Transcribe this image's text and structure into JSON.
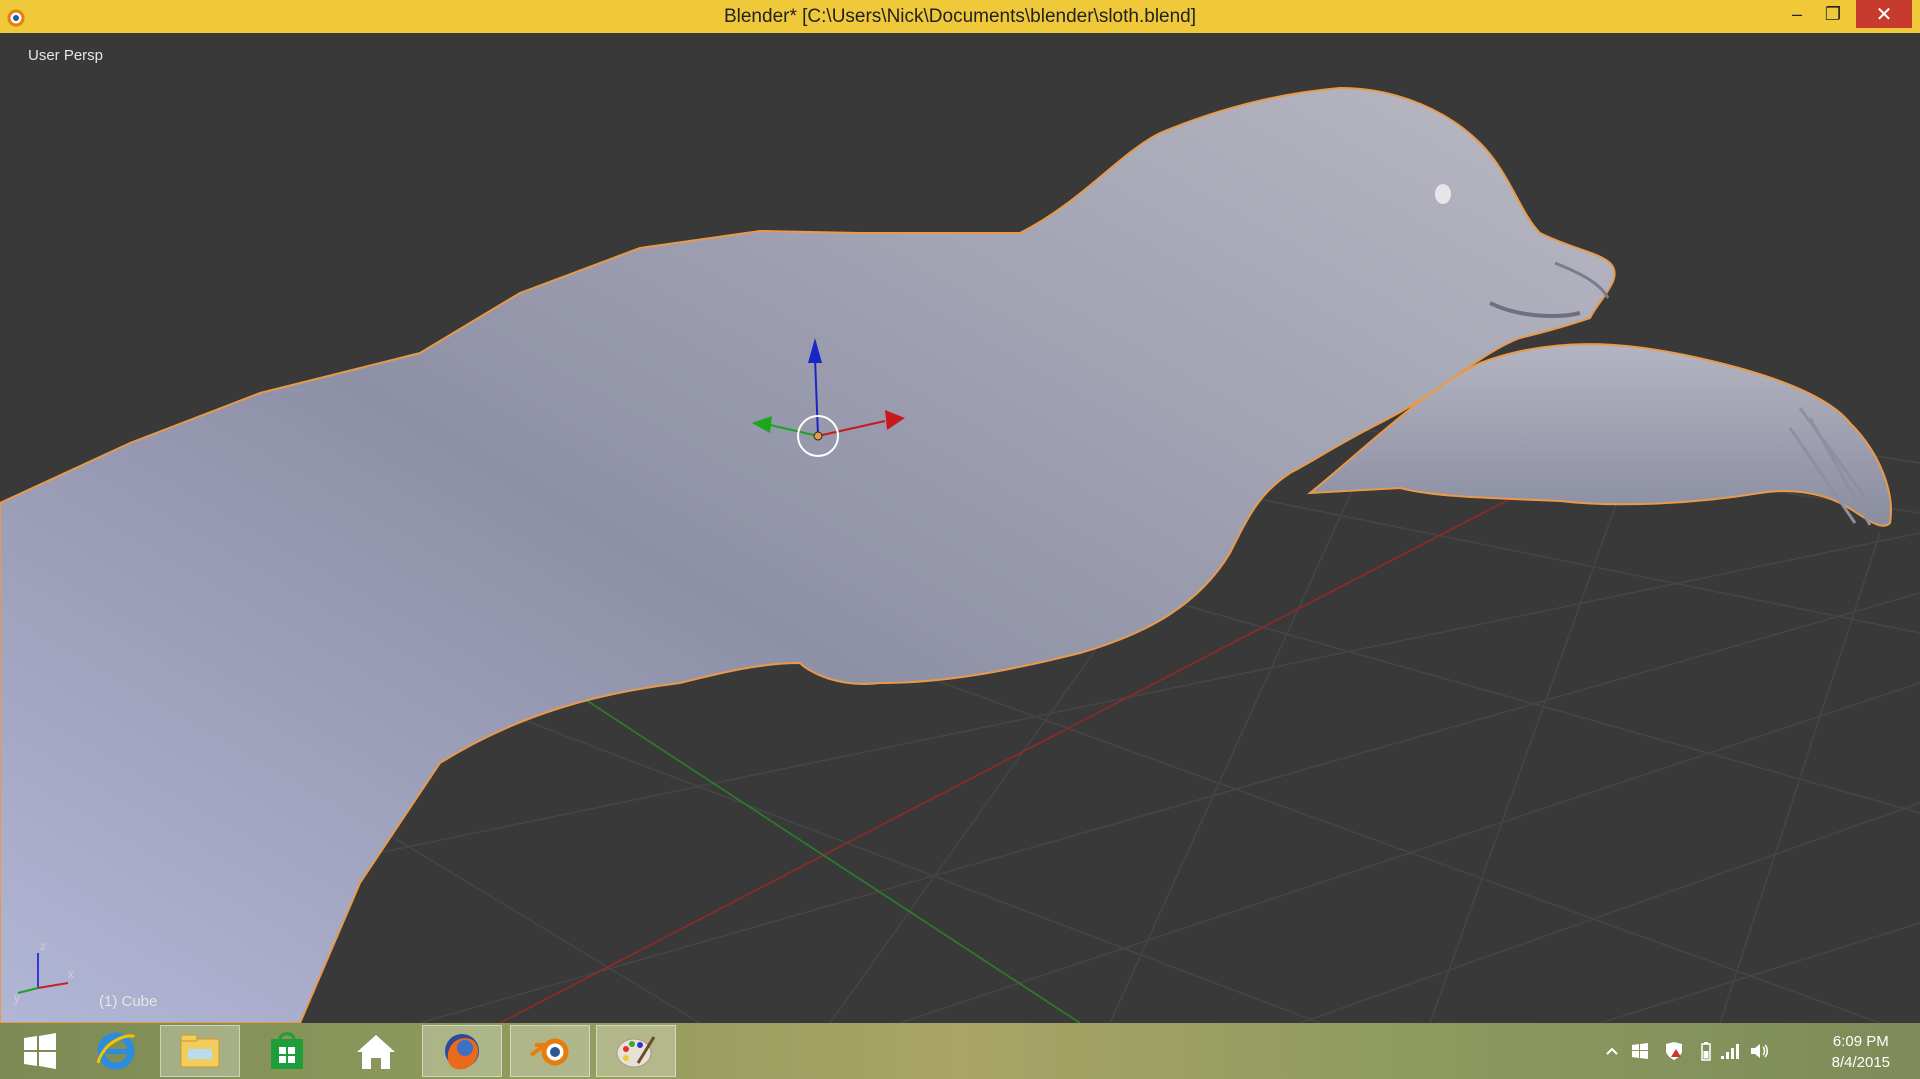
{
  "window": {
    "title": "Blender* [C:\\Users\\Nick\\Documents\\blender\\sloth.blend]",
    "minimize_label": "–",
    "maximize_label": "❐",
    "close_label": "✕"
  },
  "viewport": {
    "view_label": "User Persp",
    "object_label": "(1) Cube",
    "axis_labels": {
      "x": "x",
      "y": "y",
      "z": "z"
    },
    "background_color": "#393939",
    "grid_color": "#444444",
    "x_axis_color": "#8a2a2a",
    "y_axis_color": "#2a7a2a",
    "model_color": "#a9abc0",
    "outline_color": "#f0a050"
  },
  "taskbar": {
    "items": [
      {
        "name": "start-icon"
      },
      {
        "name": "internet-explorer-icon"
      },
      {
        "name": "file-explorer-icon"
      },
      {
        "name": "store-icon"
      },
      {
        "name": "home-icon"
      },
      {
        "name": "firefox-icon"
      },
      {
        "name": "blender-icon",
        "active": true
      },
      {
        "name": "paint-icon"
      }
    ],
    "clock": {
      "time": "6:09 PM",
      "date": "8/4/2015"
    },
    "tray_icons": [
      "show-hidden-icon",
      "windows-flag-icon",
      "action-center-icon",
      "battery-icon",
      "signal-icon",
      "volume-icon"
    ]
  }
}
